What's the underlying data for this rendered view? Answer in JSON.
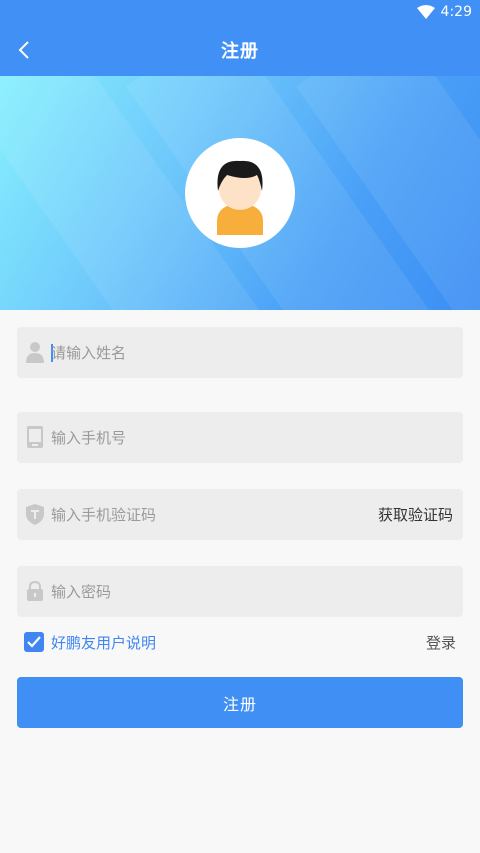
{
  "status_bar": {
    "time": "4:29"
  },
  "header": {
    "title": "注册"
  },
  "form": {
    "name_placeholder": "请输入姓名",
    "phone_placeholder": "输入手机号",
    "code_placeholder": "输入手机验证码",
    "get_code_label": "获取验证码",
    "password_placeholder": "输入密码"
  },
  "agreement": {
    "checked": true,
    "label": "好鹏友用户说明"
  },
  "login_label": "登录",
  "submit_label": "注册",
  "colors": {
    "primary": "#4190f5",
    "field_bg": "#ededed",
    "link": "#3f86f3"
  }
}
